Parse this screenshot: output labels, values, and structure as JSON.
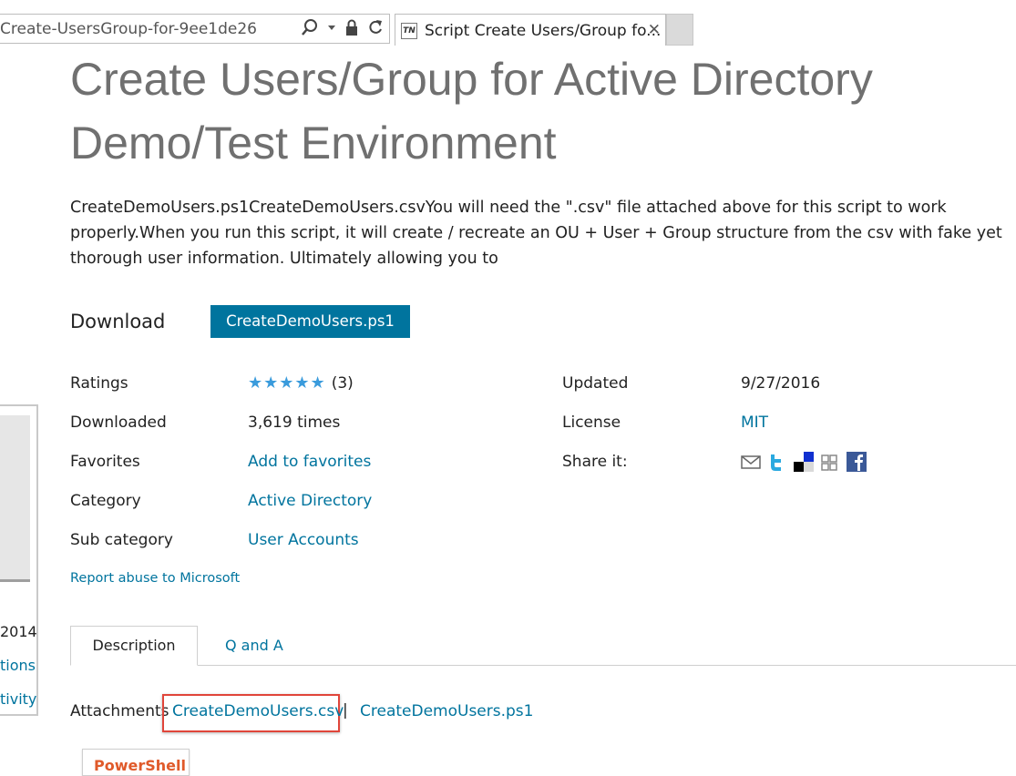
{
  "browser": {
    "address_text": "Create-UsersGroup-for-9ee1de26",
    "tab_title": "Script Create Users/Group fo...",
    "tab_favicon_text": "TN"
  },
  "sidebar_partial": {
    "year_text": "2014",
    "link1_text": "tions",
    "link2_text": "tivity"
  },
  "page": {
    "title": "Create Users/Group for Active Directory Demo/Test Environment",
    "summary": "CreateDemoUsers.ps1CreateDemoUsers.csvYou will need the \".csv\" file attached above for this script to work properly.When you run this script, it will create / recreate an OU + User + Group structure from the csv with fake yet thorough user information. Ultimately allowing you to",
    "download_label": "Download",
    "download_button": "CreateDemoUsers.ps1"
  },
  "meta": {
    "ratings_label": "Ratings",
    "stars": "★★★★★",
    "ratings_count": "(3)",
    "downloaded_label": "Downloaded",
    "downloaded_value": "3,619 times",
    "favorites_label": "Favorites",
    "favorites_link": "Add to favorites",
    "category_label": "Category",
    "category_value": "Active Directory",
    "subcategory_label": "Sub category",
    "subcategory_value": "User Accounts",
    "updated_label": "Updated",
    "updated_value": "9/27/2016",
    "license_label": "License",
    "license_value": "MIT",
    "share_label": "Share it:",
    "report_link": "Report abuse to Microsoft"
  },
  "share_icons": [
    "email-icon",
    "twitter-icon",
    "delicious-icon",
    "digg-icon",
    "facebook-icon"
  ],
  "tabs": {
    "description": "Description",
    "qa": "Q and A"
  },
  "attachments": {
    "label": "Attachments",
    "file1": "CreateDemoUsers.csv",
    "separator": "|",
    "file2": "CreateDemoUsers.ps1"
  },
  "language_tab": "PowerShell",
  "colors": {
    "accent": "#00749e",
    "highlight_box": "#e0453a",
    "star": "#3a9bdc"
  }
}
